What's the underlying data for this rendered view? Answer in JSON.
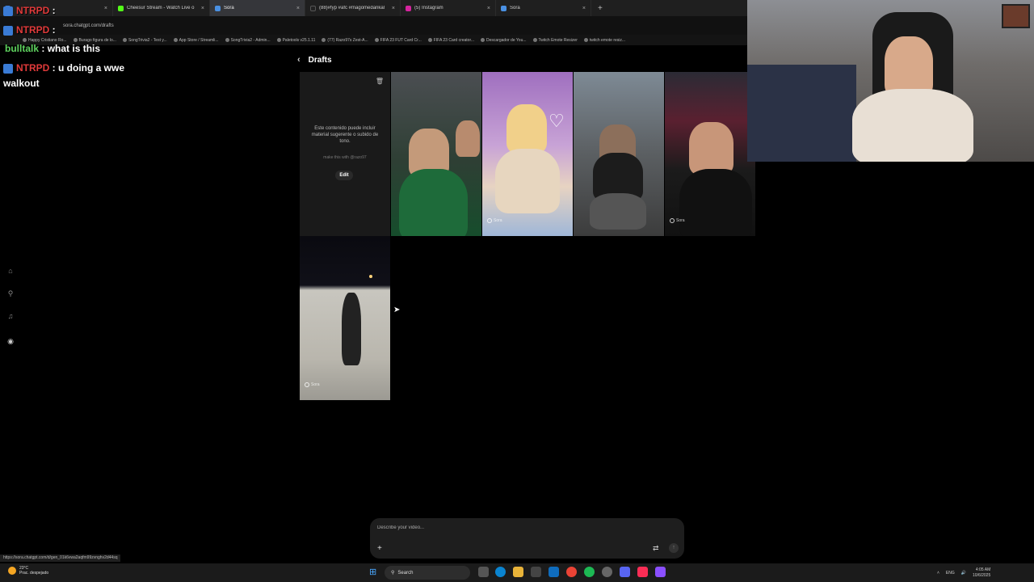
{
  "browser": {
    "tabs": [
      {
        "label": "",
        "fav_color": "#3a7bd5",
        "active": false
      },
      {
        "label": "Cheesur Stream - Watch Live o",
        "fav_color": "#53fc18",
        "active": false
      },
      {
        "label": "Sora",
        "fav_color": "#4a90e2",
        "active": true
      },
      {
        "label": "(88)#fyp #afc #magomedankal",
        "fav_color": "#222222",
        "active": false
      },
      {
        "label": "(5) Instagram",
        "fav_color": "#d6249f",
        "active": false
      },
      {
        "label": "Sora",
        "fav_color": "#4a90e2",
        "active": false
      }
    ],
    "tab_close": "×",
    "new_tab": "+",
    "url": "sora.chatgpt.com/drafts",
    "bookmarks": [
      "Happy Cristiano Ro...",
      "Burago figura de lo...",
      "SongTrivia2 - Test y...",
      "App Store / Streamli...",
      "SongTrivia2 - Admin...",
      "Paletools v25.1.11",
      "(77) Razo97s Zest-A...",
      "FIFA 23 FUT Card Cr...",
      "FIFA 23 Card creator...",
      "Descargador de You...",
      "Twitch Emote Resizer",
      "twitch emote resiz..."
    ],
    "status_url": "https://sora.chatgpt.com/d/gen_01k6vwa2aqfm99zvnghv2d44sq"
  },
  "chat": [
    {
      "user": "NTRPD",
      "message": "",
      "user_color": "#e03a3a"
    },
    {
      "user": "NTRPD",
      "message": "",
      "user_color": "#e03a3a"
    },
    {
      "user": "bulltalk",
      "message": "what is this",
      "user_color": "#5fd35f"
    },
    {
      "user": "NTRPD",
      "message": "u doing a wwe walkout",
      "user_color": "#e03a3a"
    }
  ],
  "chat_sep": " : ",
  "rail_icons": [
    "home-icon",
    "search-icon",
    "notifications-icon",
    "profile-icon"
  ],
  "drafts": {
    "back": "‹",
    "title": "Drafts",
    "notice_card": {
      "message": "Este contenido puede incluir material sugerente o subido de tono.",
      "sub": "make this with @razo97",
      "edit_label": "Edit",
      "trash": "🗑"
    },
    "watermark": "Sora"
  },
  "prompt": {
    "placeholder": "Describe your video...",
    "add": "+",
    "settings": "⇄",
    "send": "↑"
  },
  "taskbar": {
    "temperature": "23°C",
    "weather_desc": "Prac. despejado",
    "search": "Search",
    "language": "ENG",
    "time": "4:05 AM",
    "date": "10/6/2025"
  }
}
